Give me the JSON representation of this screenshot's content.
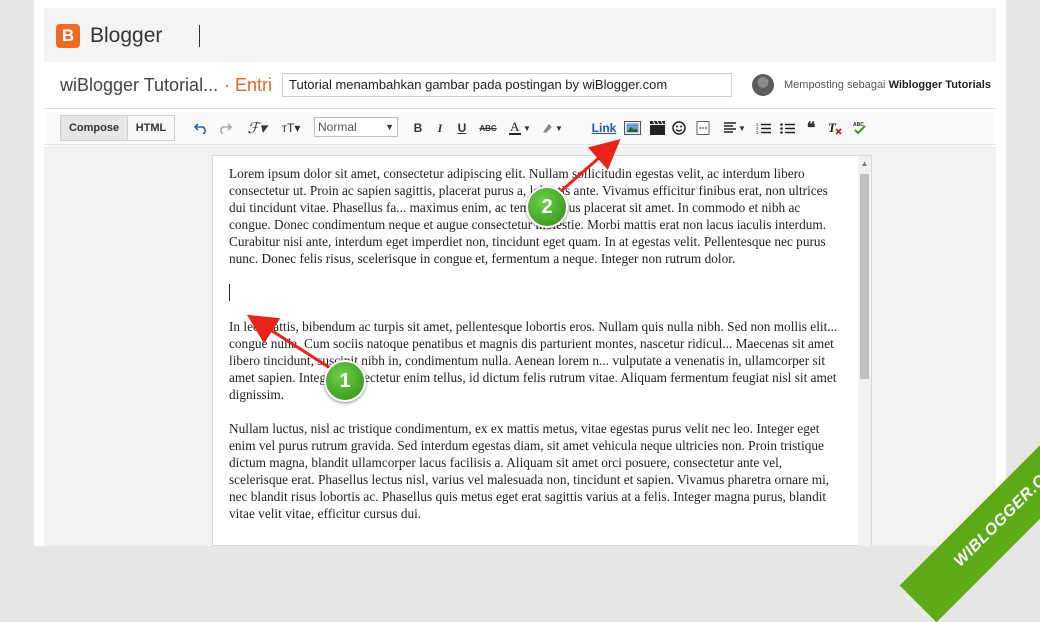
{
  "app": {
    "name": "Blogger",
    "logo_letter": "B",
    "brand_color": "#f06a24"
  },
  "header": {
    "blog_title": "wiBlogger Tutorial...",
    "separator_status": "· Entri",
    "post_title": "Tutorial menambahkan gambar pada postingan by wiBlogger.com",
    "posting_as_label": "Memposting sebagai",
    "posting_as_user": "Wiblogger Tutorials"
  },
  "toolbar": {
    "compose_label": "Compose",
    "html_label": "HTML",
    "font_size_label": "Normal",
    "bold": "B",
    "italic": "I",
    "underline": "U",
    "strikethrough": "ABC",
    "link_label": "Link"
  },
  "editor": {
    "paragraphs": [
      "Lorem ipsum dolor sit amet, consectetur adipiscing elit. Nullam sollicitudin egestas velit, ac interdum libero consectetur ut. Proin ac sapien sagittis, placerat purus a, lobortis ante. Vivamus efficitur finibus erat, non ultrices dui tincidunt vitae. Phasellus fa... maximus enim, ac tempus tellus placerat sit amet. In commodo et nibh ac congue. Donec condimentum neque et augue consectetur molestie. Morbi mattis erat non lacus iaculis interdum. Curabitur nisi ante, interdum eget imperdiet non, tincidunt eget quam. In at egestas velit. Pellentesque nec purus nunc. Donec felis risus, scelerisque in congue et, fermentum a neque. Integer non rutrum dolor.",
      "In leo mattis, bibendum ac turpis sit amet, pellentesque lobortis eros. Nullam quis nulla nibh. Sed non mollis elit... congue nulla. Cum sociis natoque penatibus et magnis dis parturient montes, nascetur ridicul... Maecenas sit amet libero tincidunt, suscipit nibh in, condimentum nulla. Aenean lorem n... vulputate a venenatis in, ullamcorper sit amet sapien. Integer consectetur enim tellus, id dictum felis rutrum vitae. Aliquam fermentum feugiat nisl sit amet dignissim.",
      "Nullam luctus, nisl ac tristique condimentum, ex ex mattis metus, vitae egestas purus velit nec leo. Integer eget enim vel purus rutrum gravida. Sed interdum egestas diam, sit amet vehicula neque ultricies non. Proin tristique dictum magna, blandit ullamcorper lacus facilisis a. Aliquam sit amet orci posuere, consectetur ante vel, scelerisque erat. Phasellus lectus nisl, varius vel malesuada non, tincidunt et sapien. Vivamus pharetra ornare mi, nec blandit risus lobortis ac. Phasellus quis metus eget erat sagittis varius at a felis. Integer magna purus, blandit vitae velit vitae, efficitur cursus dui."
    ]
  },
  "annotations": {
    "step1": "1",
    "step2": "2",
    "badge_color": "#3a9a1c",
    "arrow_color": "#e8231c"
  },
  "watermark": {
    "text": "WIBLOGGER.COM",
    "color": "#5ea917"
  },
  "icons": [
    "undo-icon",
    "redo-icon",
    "font-family-icon",
    "font-size-icon",
    "text-color-icon",
    "highlight-color-icon",
    "insert-image-icon",
    "insert-video-icon",
    "insert-emoji-icon",
    "jump-break-icon",
    "align-icon",
    "numbered-list-icon",
    "bullet-list-icon",
    "quote-icon",
    "remove-format-icon",
    "spell-check-icon"
  ]
}
